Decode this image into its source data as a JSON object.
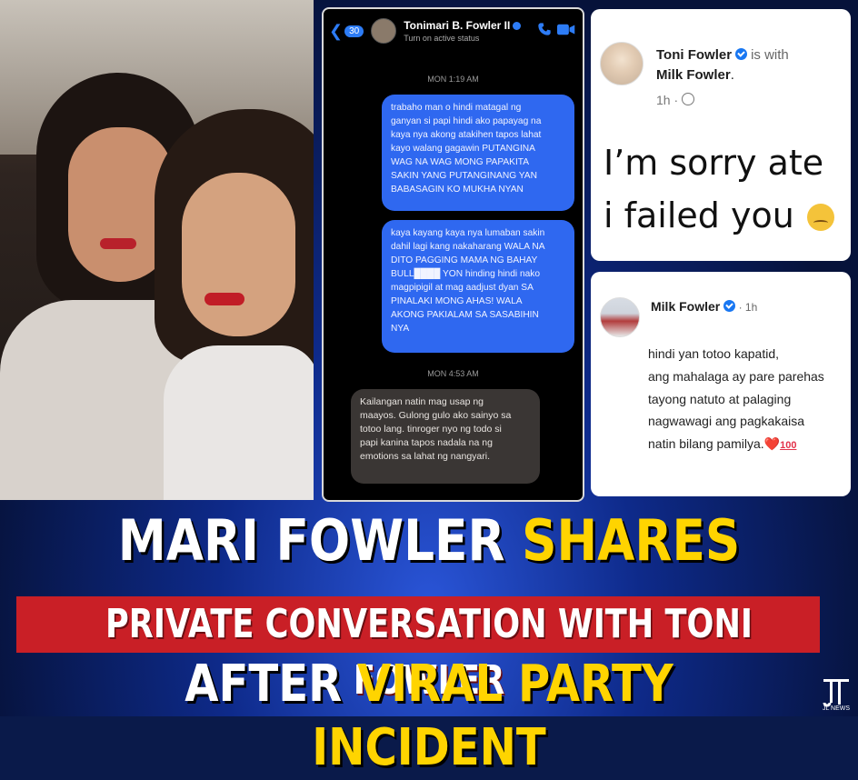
{
  "chat": {
    "badge_count": "30",
    "name": "Tonimari B. Fowler II",
    "status": "Turn on active status",
    "time1": "MON 1:19 AM",
    "msg1_lines": [
      "trabaho man o hindi matagal ng",
      "ganyan si papi hindi ako papayag na",
      "kaya nya akong atakihen tapos lahat",
      "kayo walang gagawin PUTANGINA",
      "WAG NA WAG MONG PAPAKITA",
      "SAKIN YANG PUTANGINANG YAN",
      "BABASAGIN KO MUKHA NYAN"
    ],
    "msg2_lines": [
      "kaya kayang kaya nya lumaban sakin",
      "dahil lagi kang nakaharang WALA NA",
      "DITO PAGGING MAMA NG BAHAY",
      "BULL████ YON hinding hindi nako",
      "magpipigil at mag aadjust dyan SA",
      "PINALAKI MONG AHAS! WALA",
      "AKONG PAKIALAM SA SASABIHIN",
      "NYA"
    ],
    "time2": "MON 4:53 AM",
    "msg3_lines": [
      "Kailangan natin mag usap ng",
      "maayos. Gulong gulo ako sainyo sa",
      "totoo lang. tinroger nyo ng todo si",
      "papi kanina tapos nadala na ng",
      "emotions sa lahat ng nangyari."
    ]
  },
  "post1": {
    "author": "Toni Fowler",
    "with_text": "is with",
    "tagged": "Milk Fowler",
    "tagged_suffix": ".",
    "time": "1h ·",
    "line1": "I’m sorry ate",
    "line2": "i failed you"
  },
  "post2": {
    "author": "Milk Fowler",
    "meta": " · 1h",
    "lines": [
      "hindi yan totoo kapatid,",
      "ang mahalaga ay pare parehas",
      "tayong natuto at palaging",
      "nagwawagi ang pagkakaisa",
      "natin bilang pamilya."
    ],
    "heart": "❤️",
    "hundred": "100"
  },
  "headline": {
    "line1_white": "MARI FOWLER",
    "line1_yellow": "SHARES",
    "line2": "PRIVATE CONVERSATION WITH TONI FOWLER",
    "line3_white": "AFTER",
    "line3_yellow": "VIRAL PARTY INCIDENT"
  },
  "logo": {
    "text": "JL NEWS"
  },
  "colors": {
    "accent_yellow": "#ffd400",
    "band_red": "#c91f26",
    "messenger_blue": "#2f68f0"
  }
}
